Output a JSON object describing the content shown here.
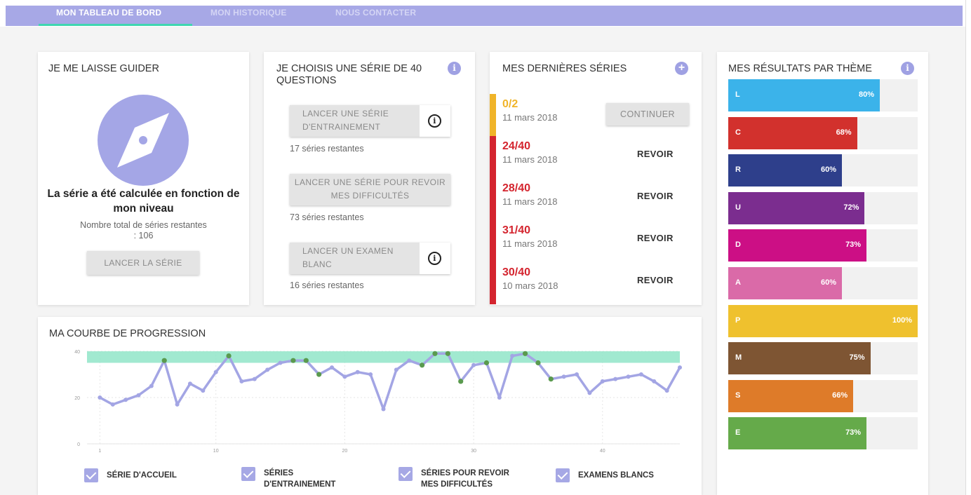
{
  "nav": {
    "items": [
      {
        "label": "MON TABLEAU DE BORD"
      },
      {
        "label": "MON HISTORIQUE"
      },
      {
        "label": "NOUS CONTACTER"
      }
    ]
  },
  "guide": {
    "title": "JE ME LAISSE GUIDER",
    "icon": "compass-icon",
    "headline": "La série a été calculée en fonction de mon niveau",
    "subtext": "Nombre total de séries restantes : 106",
    "button": "LANCER LA SÉRIE"
  },
  "choose": {
    "title": "JE CHOISIS UNE SÉRIE DE 40 QUESTIONS",
    "options": [
      {
        "label": "LANCER UNE SÉRIE D'ENTRAINEMENT",
        "remaining": "17 séries restantes",
        "info": "i"
      },
      {
        "label": "LANCER UNE SÉRIE POUR REVOIR MES DIFFICULTÉS",
        "remaining": "73 séries restantes"
      },
      {
        "label": "LANCER UN EXAMEN BLANC",
        "remaining": "16 séries restantes",
        "info": "i"
      }
    ]
  },
  "recent": {
    "title": "MES DERNIÈRES SÉRIES",
    "add_icon": "+",
    "series": [
      {
        "score": "0/2",
        "date": "11 mars 2018",
        "action": "CONTINUER",
        "color": "#f0b429"
      },
      {
        "score": "24/40",
        "date": "11 mars 2018",
        "action": "REVOIR",
        "color": "#d4252f"
      },
      {
        "score": "28/40",
        "date": "11 mars 2018",
        "action": "REVOIR",
        "color": "#d4252f"
      },
      {
        "score": "31/40",
        "date": "11 mars 2018",
        "action": "REVOIR",
        "color": "#d4252f"
      },
      {
        "score": "30/40",
        "date": "10 mars 2018",
        "action": "REVOIR",
        "color": "#d4252f"
      }
    ]
  },
  "results": {
    "title": "MES RÉSULTATS PAR THÈME",
    "info": "i",
    "themes": [
      {
        "letter": "L",
        "percent": "80%",
        "value": 80,
        "color": "#3bb3ea"
      },
      {
        "letter": "C",
        "percent": "68%",
        "value": 68,
        "color": "#d2312d"
      },
      {
        "letter": "R",
        "percent": "60%",
        "value": 60,
        "color": "#2e3f8b"
      },
      {
        "letter": "U",
        "percent": "72%",
        "value": 72,
        "color": "#7b2d8f"
      },
      {
        "letter": "D",
        "percent": "73%",
        "value": 73,
        "color": "#cc0f85"
      },
      {
        "letter": "A",
        "percent": "60%",
        "value": 60,
        "color": "#da6aa8"
      },
      {
        "letter": "P",
        "percent": "100%",
        "value": 100,
        "color": "#efc12e"
      },
      {
        "letter": "M",
        "percent": "75%",
        "value": 75,
        "color": "#7e5533"
      },
      {
        "letter": "S",
        "percent": "66%",
        "value": 66,
        "color": "#de7b29"
      },
      {
        "letter": "E",
        "percent": "73%",
        "value": 73,
        "color": "#65aa4a"
      }
    ]
  },
  "progress": {
    "title": "MA COURBE DE PROGRESSION",
    "legend": [
      {
        "label": "SÉRIE D'ACCUEIL"
      },
      {
        "label": "SÉRIES D'ENTRAINEMENT"
      },
      {
        "label": "SÉRIES POUR REVOIR MES DIFFICULTÉS"
      },
      {
        "label": "EXAMENS BLANCS"
      }
    ]
  },
  "chart_data": {
    "type": "line",
    "x_ticks": [
      "1",
      "10",
      "20",
      "30",
      "40"
    ],
    "y_ticks": [
      "0",
      "20",
      "40"
    ],
    "xlim": [
      0,
      46
    ],
    "ylim": [
      0,
      40
    ],
    "target_band": [
      35,
      40
    ],
    "band_color": "#91e5c8",
    "line_color": "#a3a5e4",
    "highlight_color": "#5a9a4e",
    "grid": true,
    "series": [
      {
        "x": [
          1,
          2,
          3,
          4,
          5,
          6,
          7,
          8,
          9,
          10,
          11,
          12,
          13,
          14,
          15,
          16,
          17,
          18,
          19,
          20,
          21,
          22,
          23,
          24,
          25,
          26,
          27,
          28,
          29,
          30,
          31,
          32,
          33,
          34,
          35,
          36,
          37,
          38,
          39,
          40,
          41,
          42,
          43,
          44,
          45,
          46
        ],
        "values": [
          20,
          17,
          19,
          21,
          25,
          36,
          17,
          26,
          23,
          31,
          38,
          27,
          28,
          32,
          35,
          36,
          36,
          30,
          33,
          29,
          31,
          30,
          15,
          32,
          36,
          34,
          39,
          39,
          27,
          34,
          35,
          20,
          38,
          39,
          35,
          28,
          29,
          30,
          22,
          27,
          28,
          29,
          30,
          27,
          23,
          33
        ],
        "highlighted": [
          6,
          11,
          16,
          17,
          18,
          26,
          27,
          28,
          29,
          31,
          34,
          35,
          36
        ]
      }
    ]
  }
}
